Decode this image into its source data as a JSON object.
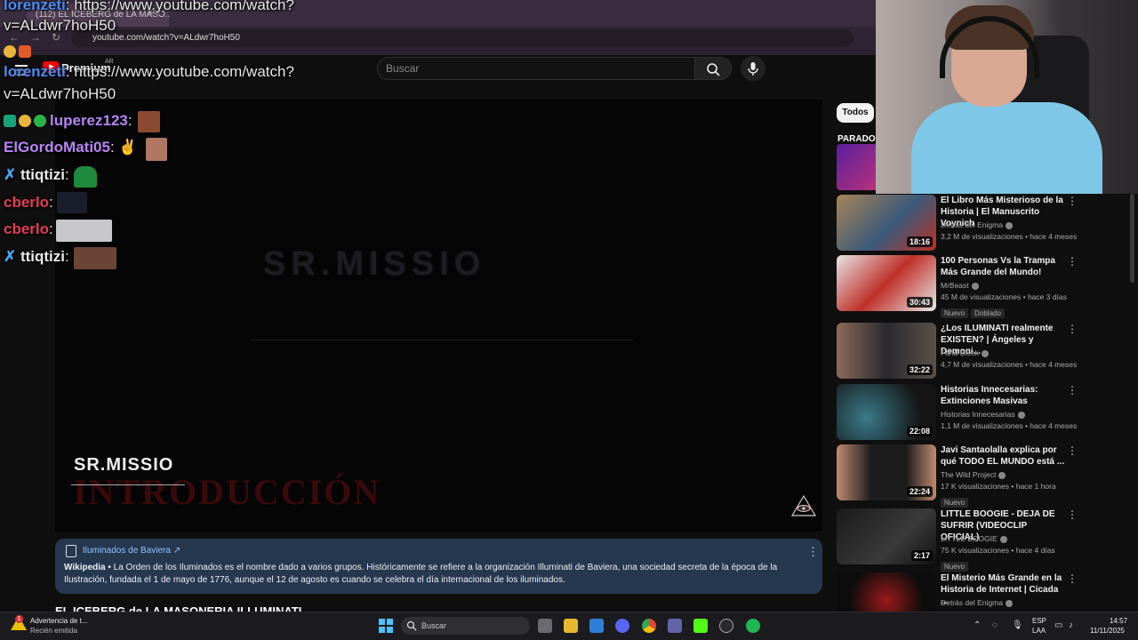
{
  "browser": {
    "tab_title": "(112) EL ICEBERG de LA MASO...",
    "tab_close": "×",
    "url": "youtube.com/watch?v=ALdwr7hoH50"
  },
  "youtube": {
    "premium": "Premium",
    "region": "AR",
    "search_placeholder": "Buscar"
  },
  "player": {
    "ghost_title": "SR.MISSIO",
    "intro_text": "INTRODUCCIÓN",
    "watermark": "SR.MISSIO"
  },
  "info_card": {
    "title": "Iluminados de Baviera ↗",
    "source": "Wikipedia",
    "body": " • La Orden de los Iluminados es el nombre dado a varios grupos. Históricamente se refiere a la organización Illuminati de Baviera, una sociedad secreta de la época de la Ilustración, fundada el 1 de mayo de 1776, aunque el 12 de agosto es cuando se celebra el día internacional de los iluminados.",
    "more": "⋮"
  },
  "video_title": "EL ICEBERG de LA MASONERIA ILLUMINATI",
  "chat": [
    {
      "user": "lorenzeti",
      "sep": ": ",
      "msg": "https://www.youtube.com/watch?",
      "msg2": "v=ALdwr7hoH50"
    },
    {
      "user": "lorenzeti",
      "sep": ": ",
      "msg": "https://www.youtube.com/watch?",
      "msg2": "v=ALdwr7hoH50"
    },
    {
      "user": "luperez123",
      "sep": ":"
    },
    {
      "user": "ElGordoMati05",
      "sep": ": ✌"
    },
    {
      "user": "ttiqtizi",
      "sep": ":"
    },
    {
      "user": "cberlo",
      "sep": ":"
    },
    {
      "user": "cberlo",
      "sep": ":"
    },
    {
      "user": "ttiqtizi",
      "sep": ":"
    }
  ],
  "sidebar": {
    "chip": "Todos",
    "parado": "PARADO",
    "recommendations": [
      {
        "title": "El Libro Más Misterioso de la Historia | El Manuscrito Voynich",
        "channel": "Detrás del Enigma",
        "meta": "3,2 M de visualizaciones • hace 4 meses",
        "duration": "18:16",
        "badges": []
      },
      {
        "title": "100 Personas Vs la Trampa Más Grande del Mundo!",
        "channel": "MrBeast",
        "meta": "45 M de visualizaciones • hace 3 días",
        "duration": "30:43",
        "badges": [
          "Nuevo",
          "Doblado"
        ]
      },
      {
        "title": "¿Los ILUMINATI realmente EXISTEN? | Ángeles y Demoni...",
        "channel": "Farid Dieck",
        "meta": "4,7 M de visualizaciones • hace 4 meses",
        "duration": "32:22",
        "badges": []
      },
      {
        "title": "Historias Innecesarias: Extinciones Masivas",
        "channel": "Historias Innecesarias",
        "meta": "1,1 M de visualizaciones • hace 4 meses",
        "duration": "22:08",
        "badges": []
      },
      {
        "title": "Javi Santaolalla explica por qué TODO EL MUNDO está ...",
        "channel": "The Wild Project",
        "meta": "17 K visualizaciones • hace 1 hora",
        "duration": "22:24",
        "badges": [
          "Nuevo"
        ]
      },
      {
        "title": "LITTLE BOOGIE - DEJA DE SUFRIR (VIDEOCLIP OFICIAL)",
        "channel": "LITTLE BOOGIE",
        "meta": "75 K visualizaciones • hace 4 días",
        "duration": "2:17",
        "badges": [
          "Nuevo"
        ]
      },
      {
        "title": "El Misterio Más Grande en la Historia de Internet | Cicada ...",
        "channel": "Detrás del Enigma",
        "meta": "",
        "duration": "",
        "badges": []
      }
    ]
  },
  "taskbar": {
    "notif_title": "Advertencia de t...",
    "notif_sub": "Recién emitida",
    "search": "Buscar",
    "lang1": "ESP",
    "lang2": "LAA",
    "time": "14:57",
    "date": "11/11/2025"
  }
}
